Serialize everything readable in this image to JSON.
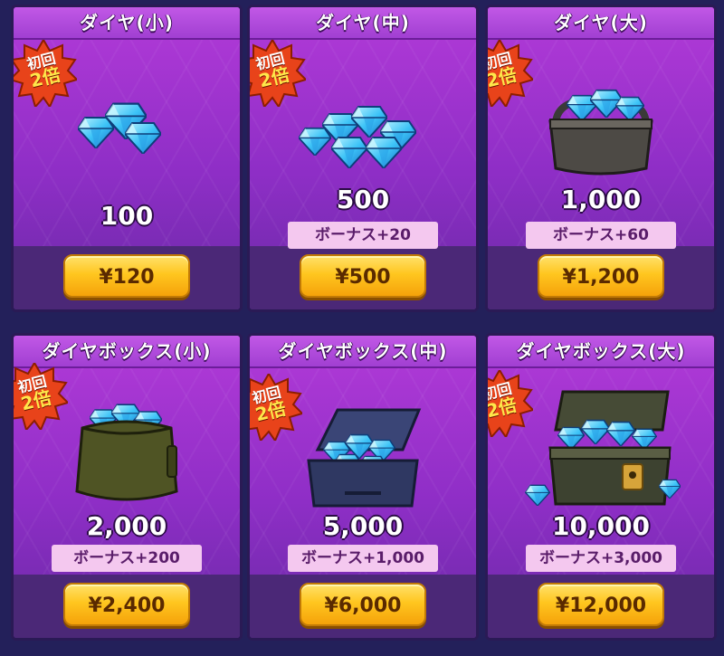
{
  "badge": {
    "line1": "初回",
    "line2": "2倍"
  },
  "colors": {
    "card": "#9a36cf",
    "bonus_bg": "#f4c8ef",
    "button": "#ffc61f",
    "badge": "#e8431a"
  },
  "products": [
    {
      "title": "ダイヤ(小)",
      "amount": "100",
      "bonus": "",
      "price": "¥120",
      "art": "small-diamond-pile-icon"
    },
    {
      "title": "ダイヤ(中)",
      "amount": "500",
      "bonus": "ボーナス+20",
      "price": "¥500",
      "art": "medium-diamond-pile-icon"
    },
    {
      "title": "ダイヤ(大)",
      "amount": "1,000",
      "bonus": "ボーナス+60",
      "price": "¥1,200",
      "art": "diamond-bag-icon"
    },
    {
      "title": "ダイヤボックス(小)",
      "amount": "2,000",
      "bonus": "ボーナス+200",
      "price": "¥2,400",
      "art": "diamond-sack-icon"
    },
    {
      "title": "ダイヤボックス(中)",
      "amount": "5,000",
      "bonus": "ボーナス+1,000",
      "price": "¥6,000",
      "art": "diamond-case-icon"
    },
    {
      "title": "ダイヤボックス(大)",
      "amount": "10,000",
      "bonus": "ボーナス+3,000",
      "price": "¥12,000",
      "art": "diamond-chest-icon"
    }
  ]
}
